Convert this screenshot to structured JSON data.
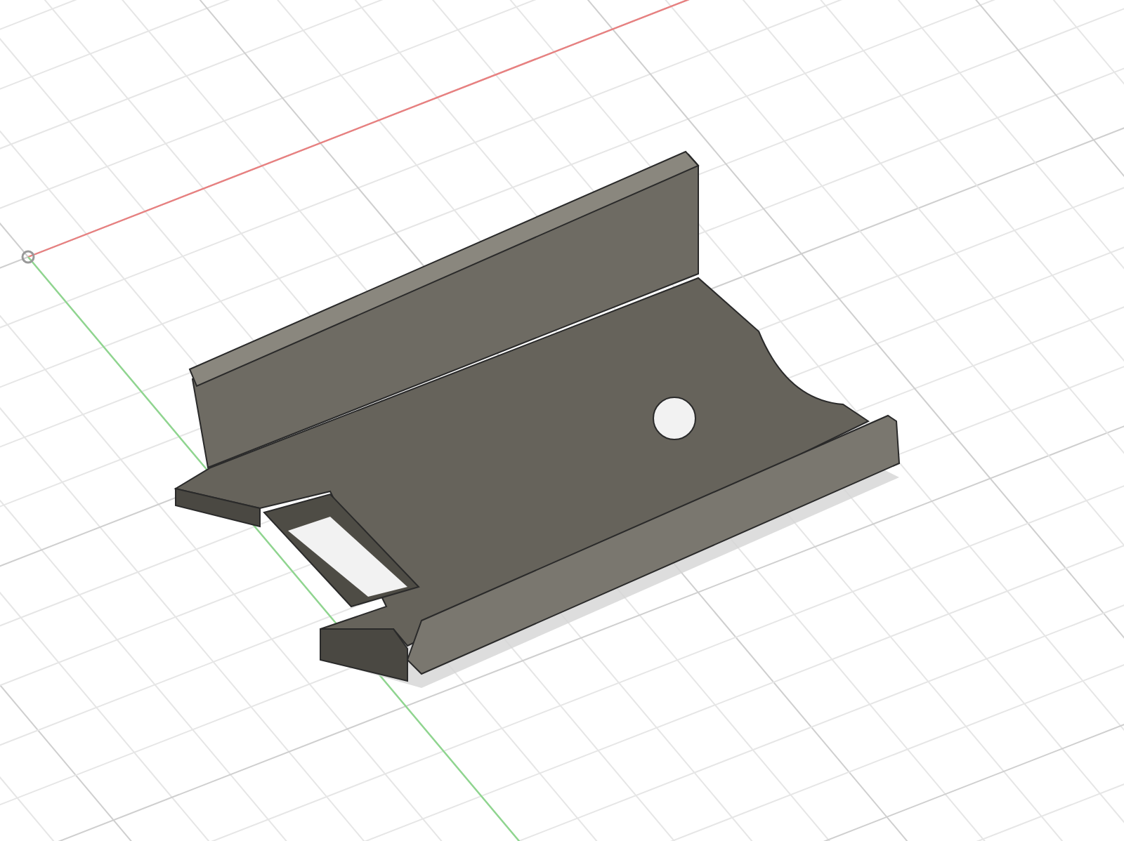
{
  "axes": [
    {
      "kind": "x",
      "color": "#e88080"
    },
    {
      "kind": "y",
      "color": "#8fd68f"
    }
  ]
}
